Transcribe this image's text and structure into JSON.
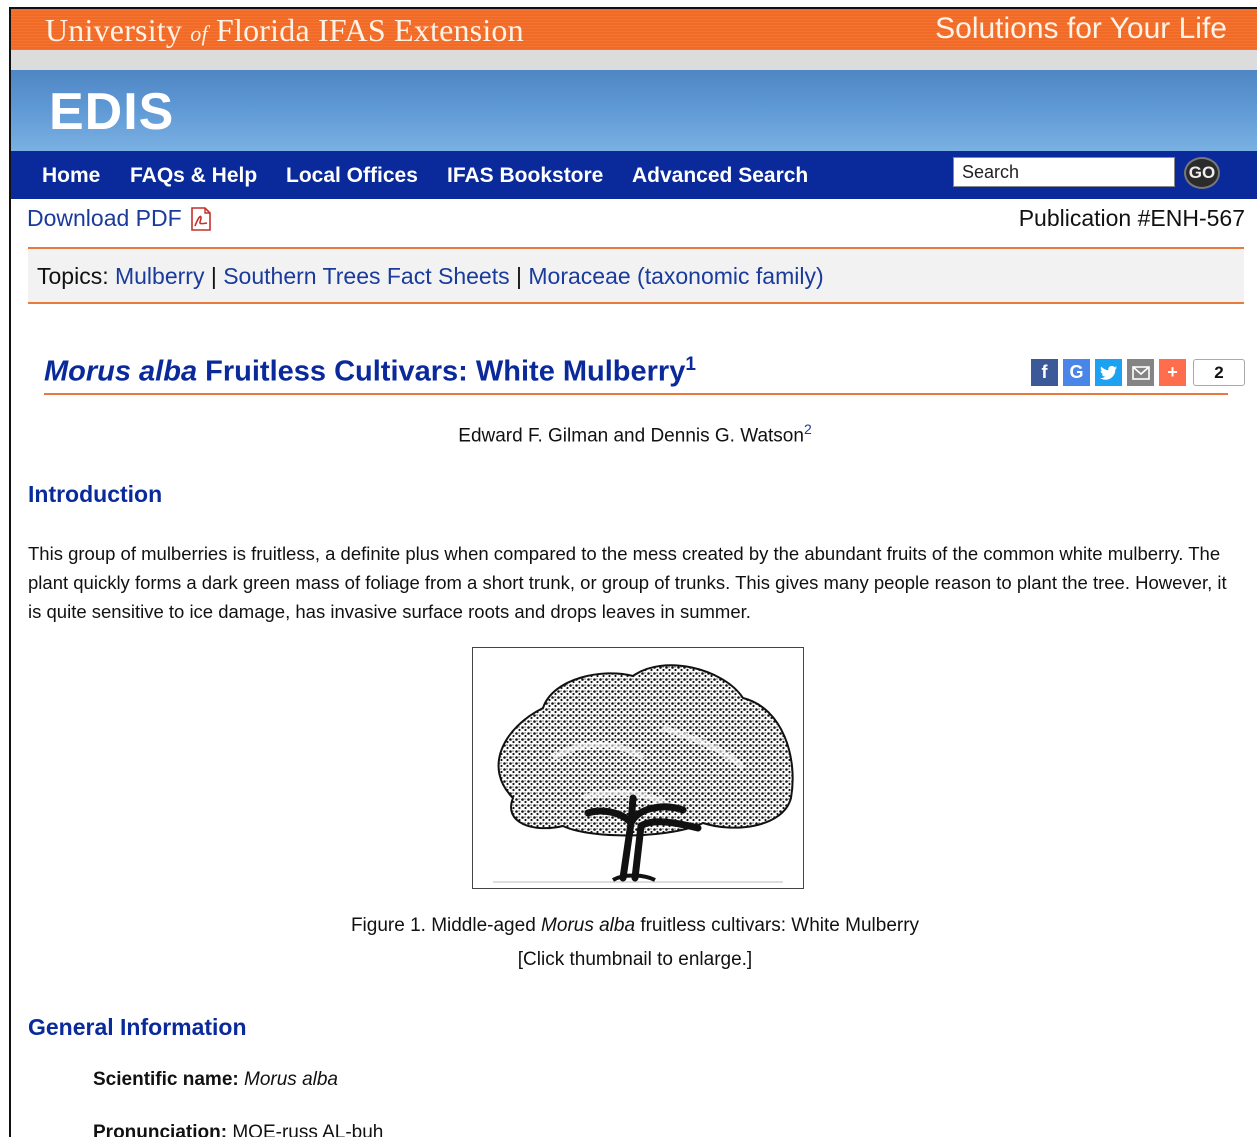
{
  "header": {
    "uf_part1": "University ",
    "uf_of": "of",
    "uf_part2": " Florida  IFAS Extension",
    "tagline": "Solutions for Your Life"
  },
  "banner": {
    "logo": "EDIS"
  },
  "nav": {
    "items": [
      "Home",
      "FAQs & Help",
      "Local Offices",
      "IFAS Bookstore",
      "Advanced Search"
    ],
    "search_placeholder": "Search",
    "go_label": "GO"
  },
  "utility": {
    "download_label": "Download PDF",
    "publication_number": "Publication #ENH-567"
  },
  "topics": {
    "prefix": "Topics: ",
    "links": [
      "Mulberry",
      "Southern Trees Fact Sheets",
      "Moraceae (taxonomic family)"
    ],
    "separator": " | "
  },
  "article": {
    "title_italic": "Morus alba",
    "title_rest": " Fruitless Cultivars: White Mulberry",
    "title_footnote": "1",
    "share_count": "2",
    "authors": "Edward F. Gilman and Dennis G. Watson",
    "authors_footnote": "2",
    "intro_heading": "Introduction",
    "intro_text": "This group of mulberries is fruitless, a definite plus when compared to the mess created by the abundant fruits of the common white mulberry. The plant quickly forms a dark green mass of foliage from a short trunk, or group of trunks. This gives many people reason to plant the tree. However, it is quite sensitive to ice damage, has invasive surface roots and drops leaves in summer.",
    "figure_caption_prefix": "Figure 1.  Middle-aged ",
    "figure_caption_italic": "Morus alba",
    "figure_caption_suffix": " fruitless cultivars: White Mulberry",
    "figure_hint": "[Click thumbnail to enlarge.]",
    "general_heading": "General Information",
    "scientific_label": "Scientific name:",
    "scientific_value": "Morus alba",
    "pronunciation_label": "Pronunciation:",
    "pronunciation_value": "MOE-russ AL-buh"
  },
  "colors": {
    "orange": "#f26b26",
    "navy": "#0a2a9b",
    "link": "#1a3a9c"
  },
  "share_icons": [
    "facebook-icon",
    "google-icon",
    "twitter-icon",
    "email-icon",
    "plus-icon"
  ]
}
